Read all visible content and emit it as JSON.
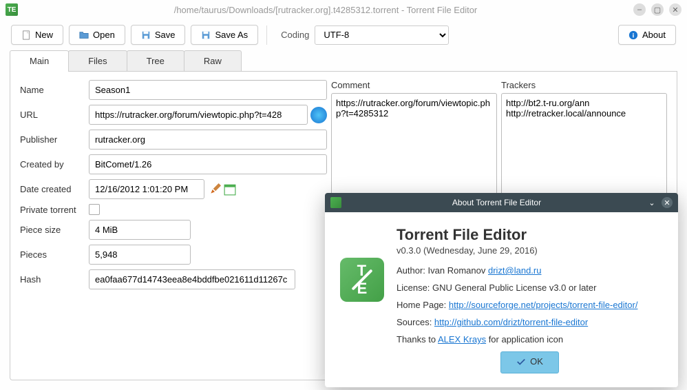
{
  "window": {
    "title": "/home/taurus/Downloads/[rutracker.org].t4285312.torrent - Torrent File Editor"
  },
  "toolbar": {
    "new": "New",
    "open": "Open",
    "save": "Save",
    "save_as": "Save As",
    "coding_label": "Coding",
    "coding_value": "UTF-8",
    "about": "About"
  },
  "tabs": {
    "main": "Main",
    "files": "Files",
    "tree": "Tree",
    "raw": "Raw"
  },
  "form": {
    "name_label": "Name",
    "name_value": "Season1",
    "url_label": "URL",
    "url_value": "https://rutracker.org/forum/viewtopic.php?t=428",
    "publisher_label": "Publisher",
    "publisher_value": "rutracker.org",
    "createdby_label": "Created by",
    "createdby_value": "BitComet/1.26",
    "date_label": "Date created",
    "date_value": "12/16/2012 1:01:20 PM",
    "private_label": "Private torrent",
    "piece_size_label": "Piece size",
    "piece_size_value": "4 MiB",
    "pieces_label": "Pieces",
    "pieces_value": "5,948",
    "hash_label": "Hash",
    "hash_value": "ea0faa677d14743eea8e4bddfbe021611d11267c"
  },
  "comment": {
    "label": "Comment",
    "value": "https://rutracker.org/forum/viewtopic.php?t=4285312"
  },
  "trackers": {
    "label": "Trackers",
    "value": "http://bt2.t-ru.org/ann\nhttp://retracker.local/announce"
  },
  "about": {
    "title": "About Torrent File Editor",
    "app_name": "Torrent File Editor",
    "version": "v0.3.0 (Wednesday, June 29, 2016)",
    "author_label": "Author: Ivan Romanov ",
    "author_email": "drizt@land.ru",
    "license": "License: GNU General Public License v3.0 or later",
    "homepage_label": "Home Page: ",
    "homepage_url": "http://sourceforge.net/projects/torrent-file-editor/",
    "sources_label": "Sources: ",
    "sources_url": "http://github.com/drizt/torrent-file-editor",
    "thanks_prefix": "Thanks to ",
    "thanks_name": "ALEX Krays",
    "thanks_suffix": " for application icon",
    "ok": "OK"
  }
}
